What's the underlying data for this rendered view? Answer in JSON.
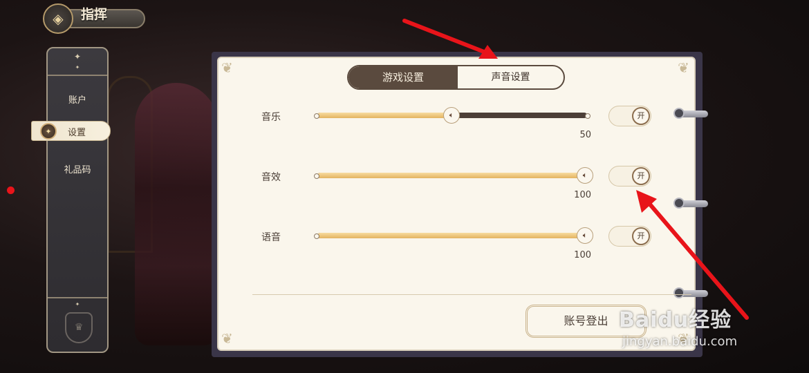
{
  "header": {
    "title": "指挥"
  },
  "sidebar": {
    "items": [
      {
        "label": "账户"
      },
      {
        "label": "设置"
      },
      {
        "label": "礼品码"
      }
    ],
    "active_index": 1
  },
  "tabs": [
    {
      "label": "游戏设置",
      "active": true
    },
    {
      "label": "声音设置",
      "active": false
    }
  ],
  "audio": {
    "rows": [
      {
        "label": "音乐",
        "value": "50",
        "toggle": "开"
      },
      {
        "label": "音效",
        "value": "100",
        "toggle": "开"
      },
      {
        "label": "语音",
        "value": "100",
        "toggle": "开"
      }
    ]
  },
  "footer": {
    "logout_label": "账号登出"
  },
  "watermark": {
    "brand": "Baidu经验",
    "url": "jingyan.baidu.com"
  },
  "colors": {
    "accent": "#5a4a3e",
    "slider_fill": "#e3b460",
    "annotation_red": "#e8141a"
  }
}
